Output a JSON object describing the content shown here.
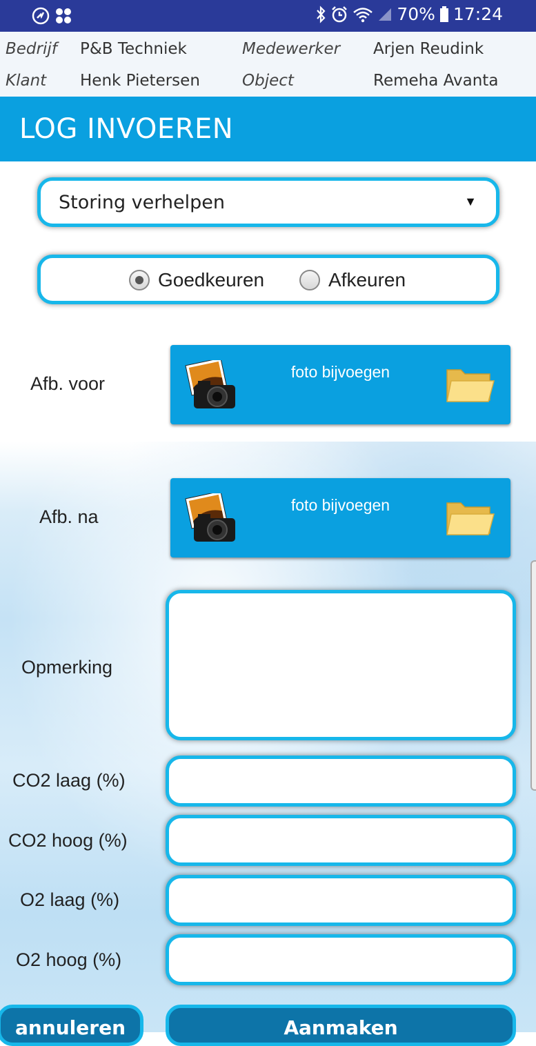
{
  "status_bar": {
    "battery": "70%",
    "time": "17:24"
  },
  "info": {
    "company_label": "Bedrijf",
    "company_value": "P&B Techniek",
    "employee_label": "Medewerker",
    "employee_value": "Arjen Reudink",
    "client_label": "Klant",
    "client_value": "Henk Pietersen",
    "object_label": "Object",
    "object_value": "Remeha Avanta"
  },
  "title": "LOG INVOEREN",
  "form": {
    "type_select": {
      "value": "Storing verhelpen"
    },
    "approval": {
      "options": [
        "Goedkeuren",
        "Afkeuren"
      ],
      "selected": "Goedkeuren"
    },
    "photo_before": {
      "label": "Afb. voor",
      "button": "foto bijvoegen"
    },
    "photo_after": {
      "label": "Afb. na",
      "button": "foto bijvoegen"
    },
    "remark": {
      "label": "Opmerking",
      "value": ""
    },
    "co2_low": {
      "label": "CO2 laag (%)",
      "value": ""
    },
    "co2_high": {
      "label": "CO2 hoog (%)",
      "value": ""
    },
    "o2_low": {
      "label": "O2 laag (%)",
      "value": ""
    },
    "o2_high": {
      "label": "O2 hoog (%)",
      "value": ""
    }
  },
  "actions": {
    "cancel": "annuleren",
    "create": "Aanmaken"
  },
  "colors": {
    "status_bar": "#2a3a99",
    "accent": "#0aa0e0",
    "border": "#17b7ea",
    "button_dark": "#0d74a8"
  }
}
